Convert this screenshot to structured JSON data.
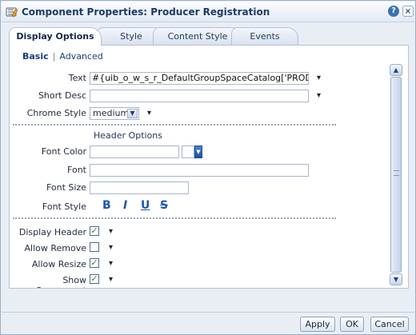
{
  "dialog": {
    "title": "Component Properties: Producer Registration",
    "help_label": "?",
    "close_label": "×"
  },
  "tabs": [
    {
      "label": "Display Options",
      "active": true
    },
    {
      "label": "Style",
      "active": false
    },
    {
      "label": "Content Style",
      "active": false
    },
    {
      "label": "Events",
      "active": false
    }
  ],
  "subtabs": {
    "basic": "Basic",
    "separator": "|",
    "advanced": "Advanced"
  },
  "form": {
    "text": {
      "label": "Text",
      "value": "#{uib_o_w_s_r_DefaultGroupSpaceCatalog['PRODUCER"
    },
    "short_desc": {
      "label": "Short Desc",
      "value": ""
    },
    "chrome_style": {
      "label": "Chrome Style",
      "value": "medium"
    },
    "header_options": {
      "title": "Header Options"
    },
    "font_color": {
      "label": "Font Color",
      "value": ""
    },
    "font": {
      "label": "Font",
      "value": ""
    },
    "font_size": {
      "label": "Font Size",
      "value": ""
    },
    "font_style": {
      "label": "Font Style",
      "bold": "B",
      "italic": "I",
      "underline": "U",
      "strike": "S"
    },
    "display_header": {
      "label": "Display Header",
      "checked": true
    },
    "allow_remove": {
      "label": "Allow Remove",
      "checked": false
    },
    "allow_resize": {
      "label": "Allow Resize",
      "checked": true
    },
    "show_component": {
      "label": "Show Component",
      "checked": true
    }
  },
  "icons": {
    "chevron": "▾",
    "check": "✓",
    "scroll_up": "▲",
    "scroll_down": "▼"
  },
  "footer": {
    "apply": "Apply",
    "ok": "OK",
    "cancel": "Cancel"
  }
}
